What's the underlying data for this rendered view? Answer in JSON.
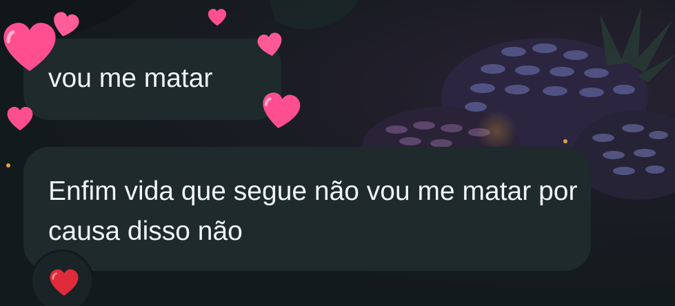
{
  "chat": {
    "messages": [
      {
        "text": "vou me matar"
      },
      {
        "text": "Enfim vida que segue não vou me matar por causa disso não"
      }
    ],
    "reaction": {
      "icon": "red-heart-icon"
    }
  },
  "theme": {
    "bubble_color": "#1e2a2c",
    "text_color": "#f2f4f5",
    "heart_effect_color": "#ff4f8f",
    "reaction_heart_color": "#e02b3a"
  }
}
